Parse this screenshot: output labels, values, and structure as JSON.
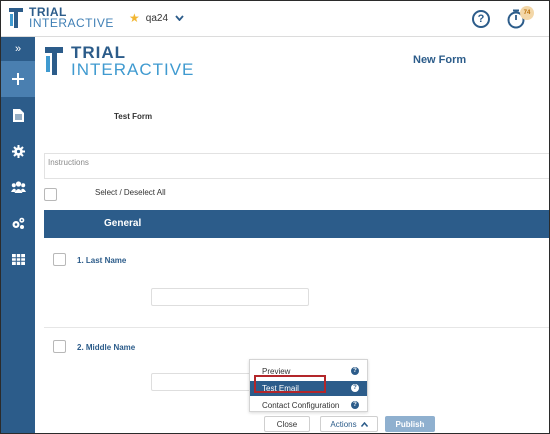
{
  "header": {
    "brand_line1": "TRIAL",
    "brand_line2": "INTERACTIVE",
    "project": "qa24",
    "help_label": "?",
    "timer_count": "74"
  },
  "sidebar": {
    "items": [
      {
        "icon": "expand-chevrons-icon"
      },
      {
        "icon": "plus-icon"
      },
      {
        "icon": "document-icon"
      },
      {
        "icon": "gear-icon"
      },
      {
        "icon": "users-icon"
      },
      {
        "icon": "gears-icon"
      },
      {
        "icon": "table-icon"
      }
    ]
  },
  "form": {
    "brand_line1": "TRIAL",
    "brand_line2": "INTERACTIVE",
    "title": "New Form",
    "name": "Test Form",
    "instructions_placeholder": "Instructions",
    "select_all_label": "Select / Deselect All",
    "section_title": "General",
    "fields": [
      {
        "label": "1. Last Name",
        "value": ""
      },
      {
        "label": "2. Middle Name",
        "value": ""
      }
    ]
  },
  "actions_menu": {
    "items": [
      {
        "label": "Preview"
      },
      {
        "label": "Test Email"
      },
      {
        "label": "Contact Configuration"
      }
    ]
  },
  "buttons": {
    "close": "Close",
    "actions": "Actions",
    "publish": "Publish"
  },
  "colors": {
    "primary": "#2c5c8a",
    "accent": "#3f9ad0",
    "highlight": "#b3262a",
    "star": "#f2b632"
  }
}
